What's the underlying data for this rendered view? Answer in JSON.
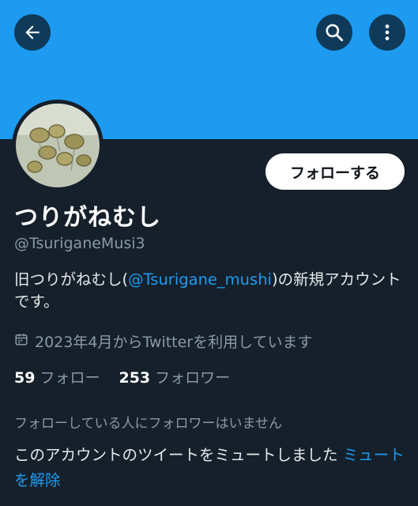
{
  "header": {
    "back_icon": "arrow-left-icon",
    "search_icon": "search-icon",
    "more_icon": "more-vertical-icon",
    "banner_color": "#1d9bf0"
  },
  "profile": {
    "follow_label": "フォローする",
    "display_name": "つりがねむし",
    "handle": "@TsuriganeMusi3",
    "bio_prefix": "旧つりがねむし(",
    "bio_mention": "@Tsurigane_mushi",
    "bio_suffix": ")の新規アカウントです。",
    "joined": "2023年4月からTwitterを利用しています",
    "following_count": "59",
    "following_label": "フォロー",
    "followers_count": "253",
    "followers_label": "フォロワー",
    "no_followers_you_follow": "フォローしている人にフォロワーはいません",
    "muted_text": "このアカウントのツイートをミュートしました",
    "unmute_label": "ミュートを解除"
  },
  "colors": {
    "accent": "#1d9bf0",
    "background": "#15202b",
    "secondary_text": "#8b98a5"
  }
}
